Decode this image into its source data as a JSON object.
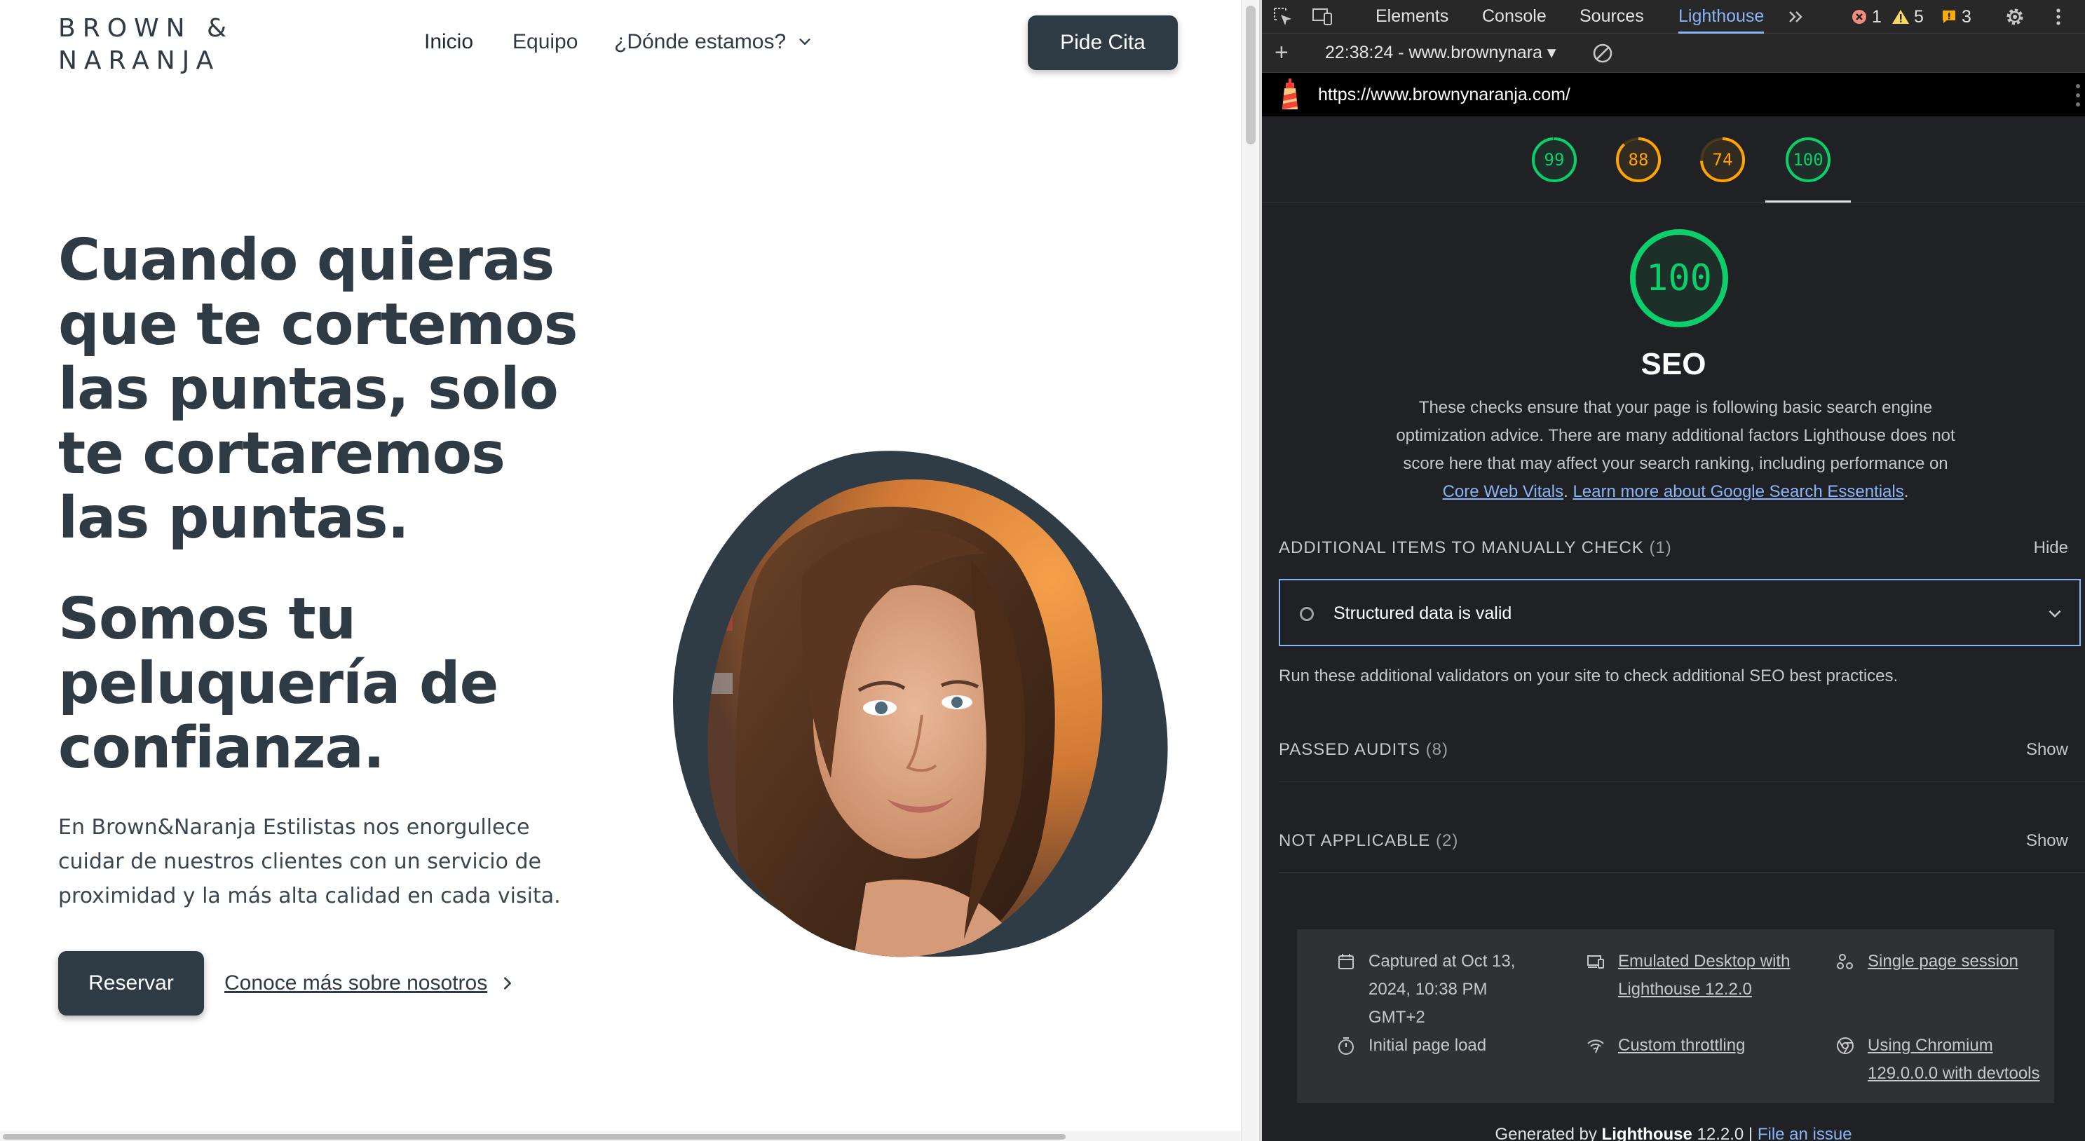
{
  "site": {
    "logo_line1": "BROWN &",
    "logo_line2": "NARANJA",
    "nav": {
      "home": "Inicio",
      "team": "Equipo",
      "where": "¿Dónde estamos?"
    },
    "cta_appointment": "Pide Cita",
    "hero_title": "Cuando quieras que te cortemos las puntas, solo te cortaremos las puntas.",
    "hero_subtitle": "Somos tu peluquería de confianza.",
    "hero_body": "En Brown&Naranja Estilistas nos enorgullece cuidar de nuestros clientes con un servicio de proximidad y la más alta calidad en cada visita.",
    "reserve_button": "Reservar",
    "learn_more": "Conoce más sobre nosotros",
    "colors": {
      "primary": "#2e3a44",
      "accent": "#f0962e"
    }
  },
  "devtools": {
    "tabs": [
      "Elements",
      "Console",
      "Sources",
      "Lighthouse"
    ],
    "active_tab": "Lighthouse",
    "errors": "1",
    "warnings": "5",
    "issues": "3",
    "report_selector": "22:38:24 - www.brownynara",
    "url": "https://www.brownynaranja.com/",
    "scores": [
      {
        "value": "99",
        "color": "#0cce6b",
        "level": 0.99
      },
      {
        "value": "88",
        "color": "#ffa400",
        "level": 0.88
      },
      {
        "value": "74",
        "color": "#ffa400",
        "level": 0.74
      },
      {
        "value": "100",
        "color": "#0cce6b",
        "level": 1.0
      }
    ],
    "seo": {
      "score": "100",
      "title": "SEO",
      "desc_text": "These checks ensure that your page is following basic search engine optimization advice. There are many additional factors Lighthouse does not score here that may affect your search ranking, including performance on",
      "link1": "Core Web Vitals",
      "link2": "Learn more about Google Search Essentials"
    },
    "manual_check": {
      "title": "ADDITIONAL ITEMS TO MANUALLY CHECK",
      "count": "(1)",
      "action": "Hide",
      "item": "Structured data is valid",
      "description": "Run these additional validators on your site to check additional SEO best practices."
    },
    "passed": {
      "title": "PASSED AUDITS",
      "count": "(8)",
      "action": "Show"
    },
    "not_applicable": {
      "title": "NOT APPLICABLE",
      "count": "(2)",
      "action": "Show"
    },
    "env": {
      "captured": "Captured at Oct 13, 2024, 10:38 PM GMT+2",
      "initial_load": "Initial page load",
      "emulated": "Emulated Desktop with Lighthouse 12.2.0",
      "throttling": "Custom throttling",
      "session": "Single page session",
      "chromium": "Using Chromium 129.0.0.0 with devtools"
    },
    "footer": {
      "prefix": "Generated by",
      "brand": "Lighthouse",
      "version": "12.2.0 |",
      "link": "File an issue"
    }
  }
}
